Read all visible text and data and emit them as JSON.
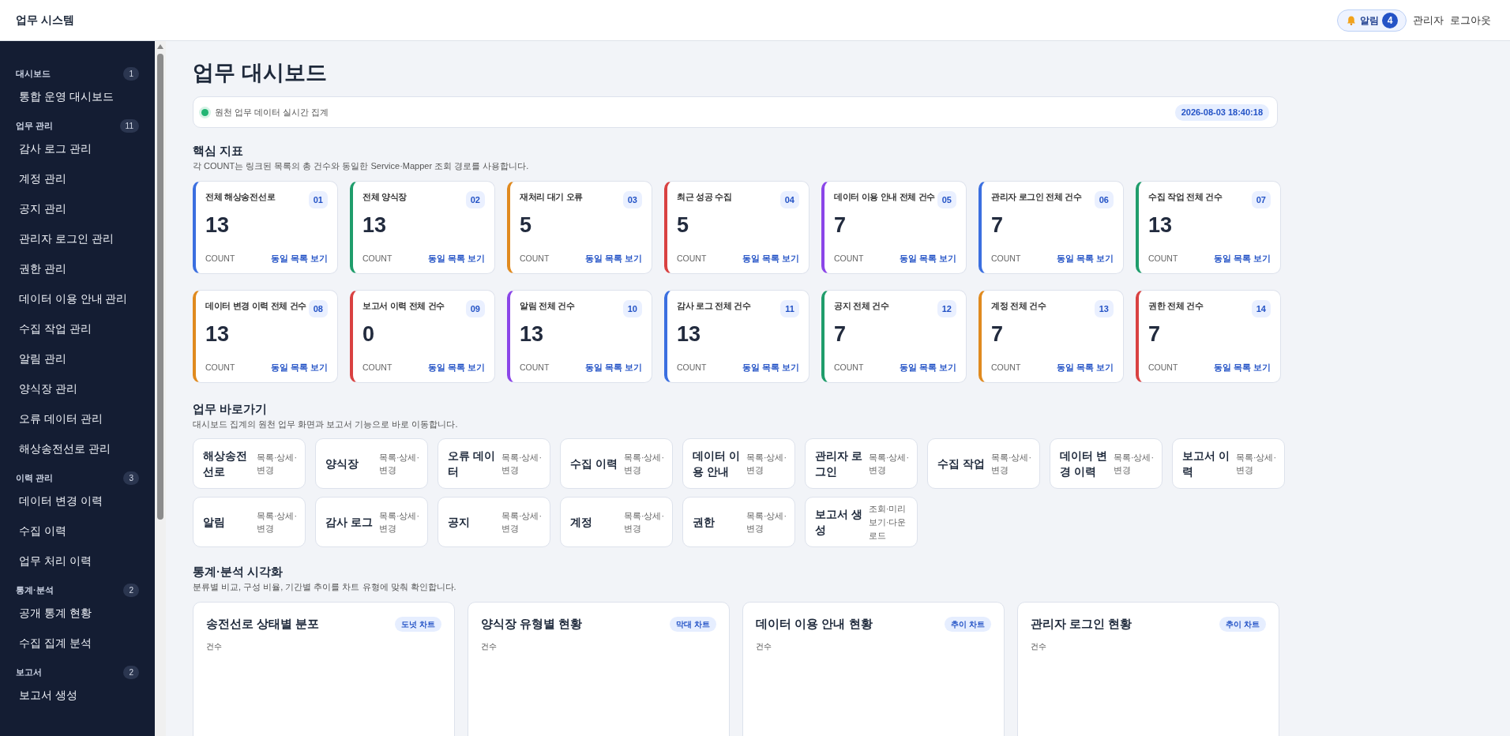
{
  "header": {
    "brand": "업무 시스템",
    "alert": {
      "label": "알림",
      "count": "4"
    },
    "user": "관리자",
    "logout": "로그아웃"
  },
  "sidebar": {
    "groups": [
      {
        "title": "대시보드",
        "count": "1",
        "items": [
          {
            "label": "통합 운영 대시보드",
            "selected": false
          }
        ]
      },
      {
        "title": "업무 관리",
        "count": "11",
        "items": [
          {
            "label": "감사 로그 관리",
            "selected": false
          },
          {
            "label": "계정 관리",
            "selected": false
          },
          {
            "label": "공지 관리",
            "selected": false
          },
          {
            "label": "관리자 로그인 관리",
            "selected": false
          },
          {
            "label": "권한 관리",
            "selected": false
          },
          {
            "label": "데이터 이용 안내 관리",
            "selected": false
          },
          {
            "label": "수집 작업 관리",
            "selected": false
          },
          {
            "label": "알림 관리",
            "selected": false
          },
          {
            "label": "양식장 관리",
            "selected": false
          },
          {
            "label": "오류 데이터 관리",
            "selected": false
          },
          {
            "label": "해상송전선로 관리",
            "selected": false
          }
        ]
      },
      {
        "title": "이력 관리",
        "count": "3",
        "items": [
          {
            "label": "데이터 변경 이력",
            "selected": false
          },
          {
            "label": "수집 이력",
            "selected": false
          },
          {
            "label": "업무 처리 이력",
            "selected": false
          }
        ]
      },
      {
        "title": "통계·분석",
        "count": "2",
        "items": [
          {
            "label": "공개 통계 현황",
            "selected": false
          },
          {
            "label": "수집 집계 분석",
            "selected": false
          }
        ]
      },
      {
        "title": "보고서",
        "count": "2",
        "items": [
          {
            "label": "보고서 생성",
            "selected": false
          }
        ]
      }
    ]
  },
  "page_title": "업무 대시보드",
  "status_bar": {
    "live": true,
    "message": "원천 업무 데이터 실시간 집계",
    "timestamp": "2026-08-03 18:40:18"
  },
  "kpi": {
    "title": "핵심 지표",
    "subtitle": "각 COUNT는 링크된 목록의 총 건수와 동일한 Service·Mapper 조회 경로를 사용합니다.",
    "cards": [
      {
        "title": "전체 해상송전선로",
        "index": "01",
        "value": "13",
        "unit": "COUNT",
        "link": "동일 목록 보기",
        "color": "#3b6fe0"
      },
      {
        "title": "전체 양식장",
        "index": "02",
        "value": "13",
        "unit": "COUNT",
        "link": "동일 목록 보기",
        "color": "#1f9d6b"
      },
      {
        "title": "재처리 대기 오류",
        "index": "03",
        "value": "5",
        "unit": "COUNT",
        "link": "동일 목록 보기",
        "color": "#e08a1f"
      },
      {
        "title": "최근 성공 수집",
        "index": "04",
        "value": "5",
        "unit": "COUNT",
        "link": "동일 목록 보기",
        "color": "#d94141"
      },
      {
        "title": "데이터 이용 안내 전체 건수",
        "index": "05",
        "value": "7",
        "unit": "COUNT",
        "link": "동일 목록 보기",
        "color": "#8b46e8"
      },
      {
        "title": "관리자 로그인 전체 건수",
        "index": "06",
        "value": "7",
        "unit": "COUNT",
        "link": "동일 목록 보기",
        "color": "#3b6fe0"
      },
      {
        "title": "수집 작업 전체 건수",
        "index": "07",
        "value": "13",
        "unit": "COUNT",
        "link": "동일 목록 보기",
        "color": "#1f9d6b"
      },
      {
        "title": "데이터 변경 이력 전체 건수",
        "index": "08",
        "value": "13",
        "unit": "COUNT",
        "link": "동일 목록 보기",
        "color": "#e08a1f"
      },
      {
        "title": "보고서 이력 전체 건수",
        "index": "09",
        "value": "0",
        "unit": "COUNT",
        "link": "동일 목록 보기",
        "color": "#d94141"
      },
      {
        "title": "알림 전체 건수",
        "index": "10",
        "value": "13",
        "unit": "COUNT",
        "link": "동일 목록 보기",
        "color": "#8b46e8"
      },
      {
        "title": "감사 로그 전체 건수",
        "index": "11",
        "value": "13",
        "unit": "COUNT",
        "link": "동일 목록 보기",
        "color": "#3b6fe0"
      },
      {
        "title": "공지 전체 건수",
        "index": "12",
        "value": "7",
        "unit": "COUNT",
        "link": "동일 목록 보기",
        "color": "#1f9d6b"
      },
      {
        "title": "계정 전체 건수",
        "index": "13",
        "value": "7",
        "unit": "COUNT",
        "link": "동일 목록 보기",
        "color": "#e08a1f"
      },
      {
        "title": "권한 전체 건수",
        "index": "14",
        "value": "7",
        "unit": "COUNT",
        "link": "동일 목록 보기",
        "color": "#d94141"
      }
    ]
  },
  "shortcuts": {
    "title": "업무 바로가기",
    "subtitle": "대시보드 집계의 원천 업무 화면과 보고서 기능으로 바로 이동합니다.",
    "items": [
      {
        "name": "해상송전선로",
        "desc": "목록·상세·변경"
      },
      {
        "name": "양식장",
        "desc": "목록·상세·변경"
      },
      {
        "name": "오류 데이터",
        "desc": "목록·상세·변경"
      },
      {
        "name": "수집 이력",
        "desc": "목록·상세·변경"
      },
      {
        "name": "데이터 이용 안내",
        "desc": "목록·상세·변경"
      },
      {
        "name": "관리자 로그인",
        "desc": "목록·상세·변경"
      },
      {
        "name": "수집 작업",
        "desc": "목록·상세·변경"
      },
      {
        "name": "데이터 변경 이력",
        "desc": "목록·상세·변경"
      },
      {
        "name": "보고서 이력",
        "desc": "목록·상세·변경"
      },
      {
        "name": "알림",
        "desc": "목록·상세·변경"
      },
      {
        "name": "감사 로그",
        "desc": "목록·상세·변경"
      },
      {
        "name": "공지",
        "desc": "목록·상세·변경"
      },
      {
        "name": "계정",
        "desc": "목록·상세·변경"
      },
      {
        "name": "권한",
        "desc": "목록·상세·변경"
      },
      {
        "name": "보고서 생성",
        "desc": "조회·미리보기·다운로드"
      }
    ]
  },
  "stats": {
    "title": "통계·분석 시각화",
    "subtitle": "분류별 비교, 구성 비율, 기간별 추이를 차트 유형에 맞춰 확인합니다.",
    "charts": [
      {
        "title": "송전선로 상태별 분포",
        "badge": "도넛 차트",
        "ylabel": "건수"
      },
      {
        "title": "양식장 유형별 현황",
        "badge": "막대 차트",
        "ylabel": "건수"
      },
      {
        "title": "데이터 이용 안내 현황",
        "badge": "추이 차트",
        "ylabel": "건수"
      },
      {
        "title": "관리자 로그인 현황",
        "badge": "추이 차트",
        "ylabel": "건수"
      }
    ]
  }
}
